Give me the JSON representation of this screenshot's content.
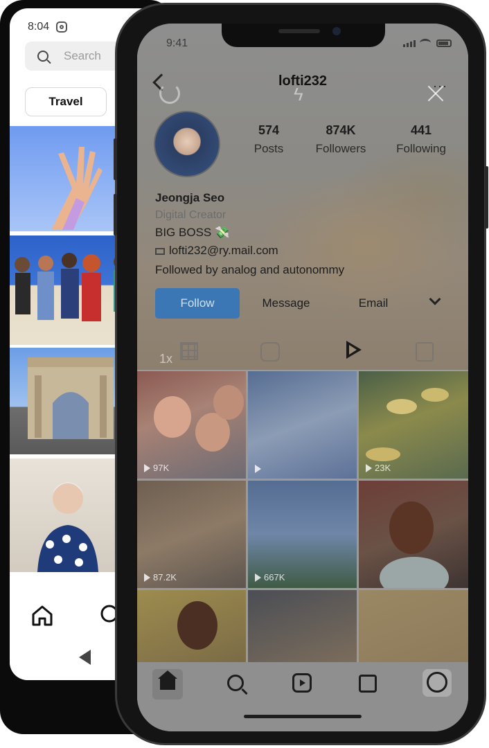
{
  "back_phone": {
    "status_time": "8:04",
    "search_placeholder": "Search",
    "chip_label": "Travel"
  },
  "front_phone": {
    "status_time": "9:41",
    "header": {
      "username": "lofti232",
      "more_label": "···"
    },
    "stats": [
      {
        "value": "574",
        "label": "Posts"
      },
      {
        "value": "874K",
        "label": "Followers"
      },
      {
        "value": "441",
        "label": "Following"
      }
    ],
    "bio": {
      "name": "Jeongja Seo",
      "category": "Digital Creator",
      "line1": "BIG BOSS 💸",
      "email": "lofti232@ry.mail.com",
      "followed_by": "Followed by analog and autonommy"
    },
    "actions": {
      "follow": "Follow",
      "message": "Message",
      "email": "Email"
    },
    "playback_speed": "1x",
    "grid_views": [
      "97K",
      "",
      "23K",
      "87.2K",
      "667K",
      "",
      "",
      "",
      ""
    ]
  },
  "colors": {
    "follow_button": "#3a77b4",
    "dim_overlay": "#9a9a9a"
  }
}
